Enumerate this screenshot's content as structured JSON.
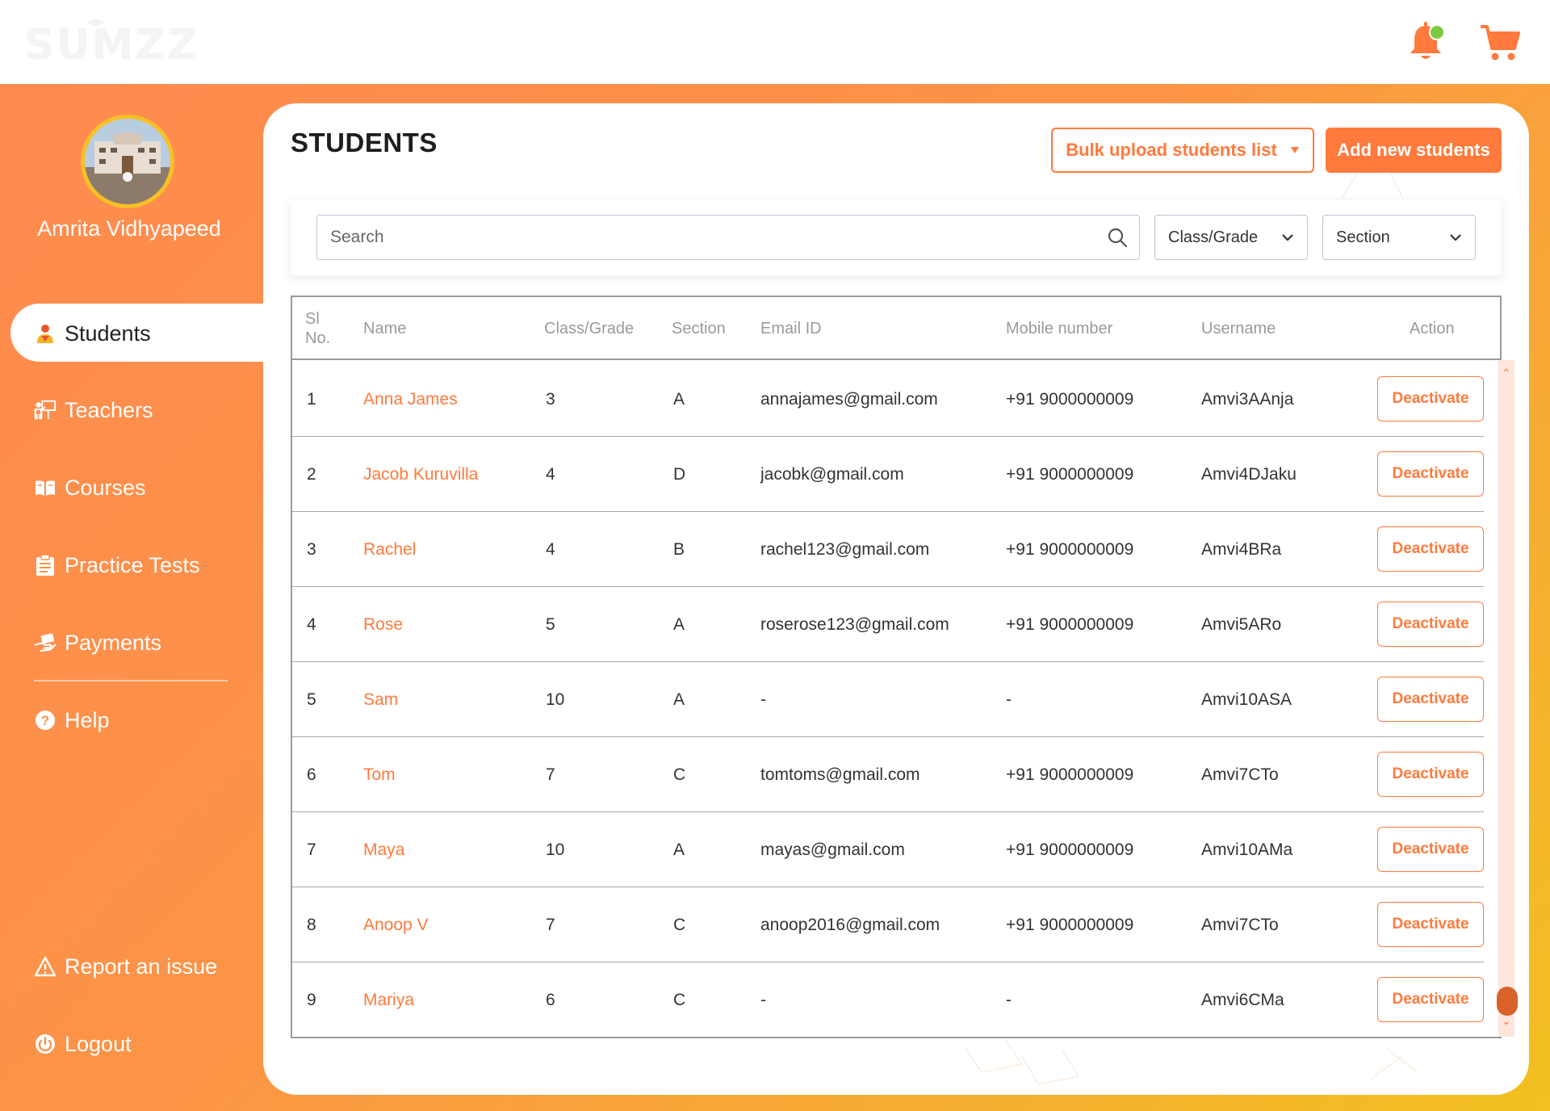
{
  "app": {
    "logo_text": "SUMZZ"
  },
  "sidebar": {
    "school_name": "Amrita Vidhyapeed",
    "items": [
      {
        "label": "Students",
        "icon": "student-icon"
      },
      {
        "label": "Teachers",
        "icon": "teacher-icon"
      },
      {
        "label": "Courses",
        "icon": "book-icon"
      },
      {
        "label": "Practice Tests",
        "icon": "clipboard-icon"
      },
      {
        "label": "Payments",
        "icon": "payment-icon"
      },
      {
        "label": "Help",
        "icon": "help-icon"
      }
    ],
    "bottom": [
      {
        "label": "Report an issue",
        "icon": "warning-icon"
      },
      {
        "label": "Logout",
        "icon": "power-icon"
      }
    ]
  },
  "header": {
    "title": "STUDENTS",
    "bulk_upload_label": "Bulk upload students list",
    "add_label": "Add new students"
  },
  "filters": {
    "search_placeholder": "Search",
    "class_label": "Class/Grade",
    "section_label": "Section"
  },
  "table": {
    "columns": [
      "Sl No.",
      "Name",
      "Class/Grade",
      "Section",
      "Email ID",
      "Mobile number",
      "Username",
      "Action"
    ],
    "action_label": "Deactivate",
    "rows": [
      {
        "sl": "1",
        "name": "Anna James",
        "class": "3",
        "section": "A",
        "email": "annajames@gmail.com",
        "mobile": "+91 9000000009",
        "username": "Amvi3AAnja"
      },
      {
        "sl": "2",
        "name": "Jacob Kuruvilla",
        "class": "4",
        "section": "D",
        "email": "jacobk@gmail.com",
        "mobile": "+91 9000000009",
        "username": "Amvi4DJaku"
      },
      {
        "sl": "3",
        "name": "Rachel",
        "class": "4",
        "section": "B",
        "email": "rachel123@gmail.com",
        "mobile": "+91 9000000009",
        "username": "Amvi4BRa"
      },
      {
        "sl": "4",
        "name": "Rose",
        "class": "5",
        "section": "A",
        "email": "roserose123@gmail.com",
        "mobile": "+91 9000000009",
        "username": "Amvi5ARo"
      },
      {
        "sl": "5",
        "name": "Sam",
        "class": "10",
        "section": "A",
        "email": "-",
        "mobile": "-",
        "username": "Amvi10ASA"
      },
      {
        "sl": "6",
        "name": "Tom",
        "class": "7",
        "section": "C",
        "email": "tomtoms@gmail.com",
        "mobile": "+91 9000000009",
        "username": "Amvi7CTo"
      },
      {
        "sl": "7",
        "name": "Maya",
        "class": "10",
        "section": "A",
        "email": "mayas@gmail.com",
        "mobile": "+91 9000000009",
        "username": "Amvi10AMa"
      },
      {
        "sl": "8",
        "name": "Anoop V",
        "class": "7",
        "section": "C",
        "email": "anoop2016@gmail.com",
        "mobile": "+91 9000000009",
        "username": "Amvi7CTo"
      },
      {
        "sl": "9",
        "name": "Mariya",
        "class": "6",
        "section": "C",
        "email": "-",
        "mobile": "-",
        "username": "Amvi6CMa"
      }
    ]
  },
  "colors": {
    "accent": "#ff7a3c",
    "notification_dot": "#7ccb3f",
    "gradient_start": "#ff8a4f",
    "gradient_end": "#f2c020"
  }
}
